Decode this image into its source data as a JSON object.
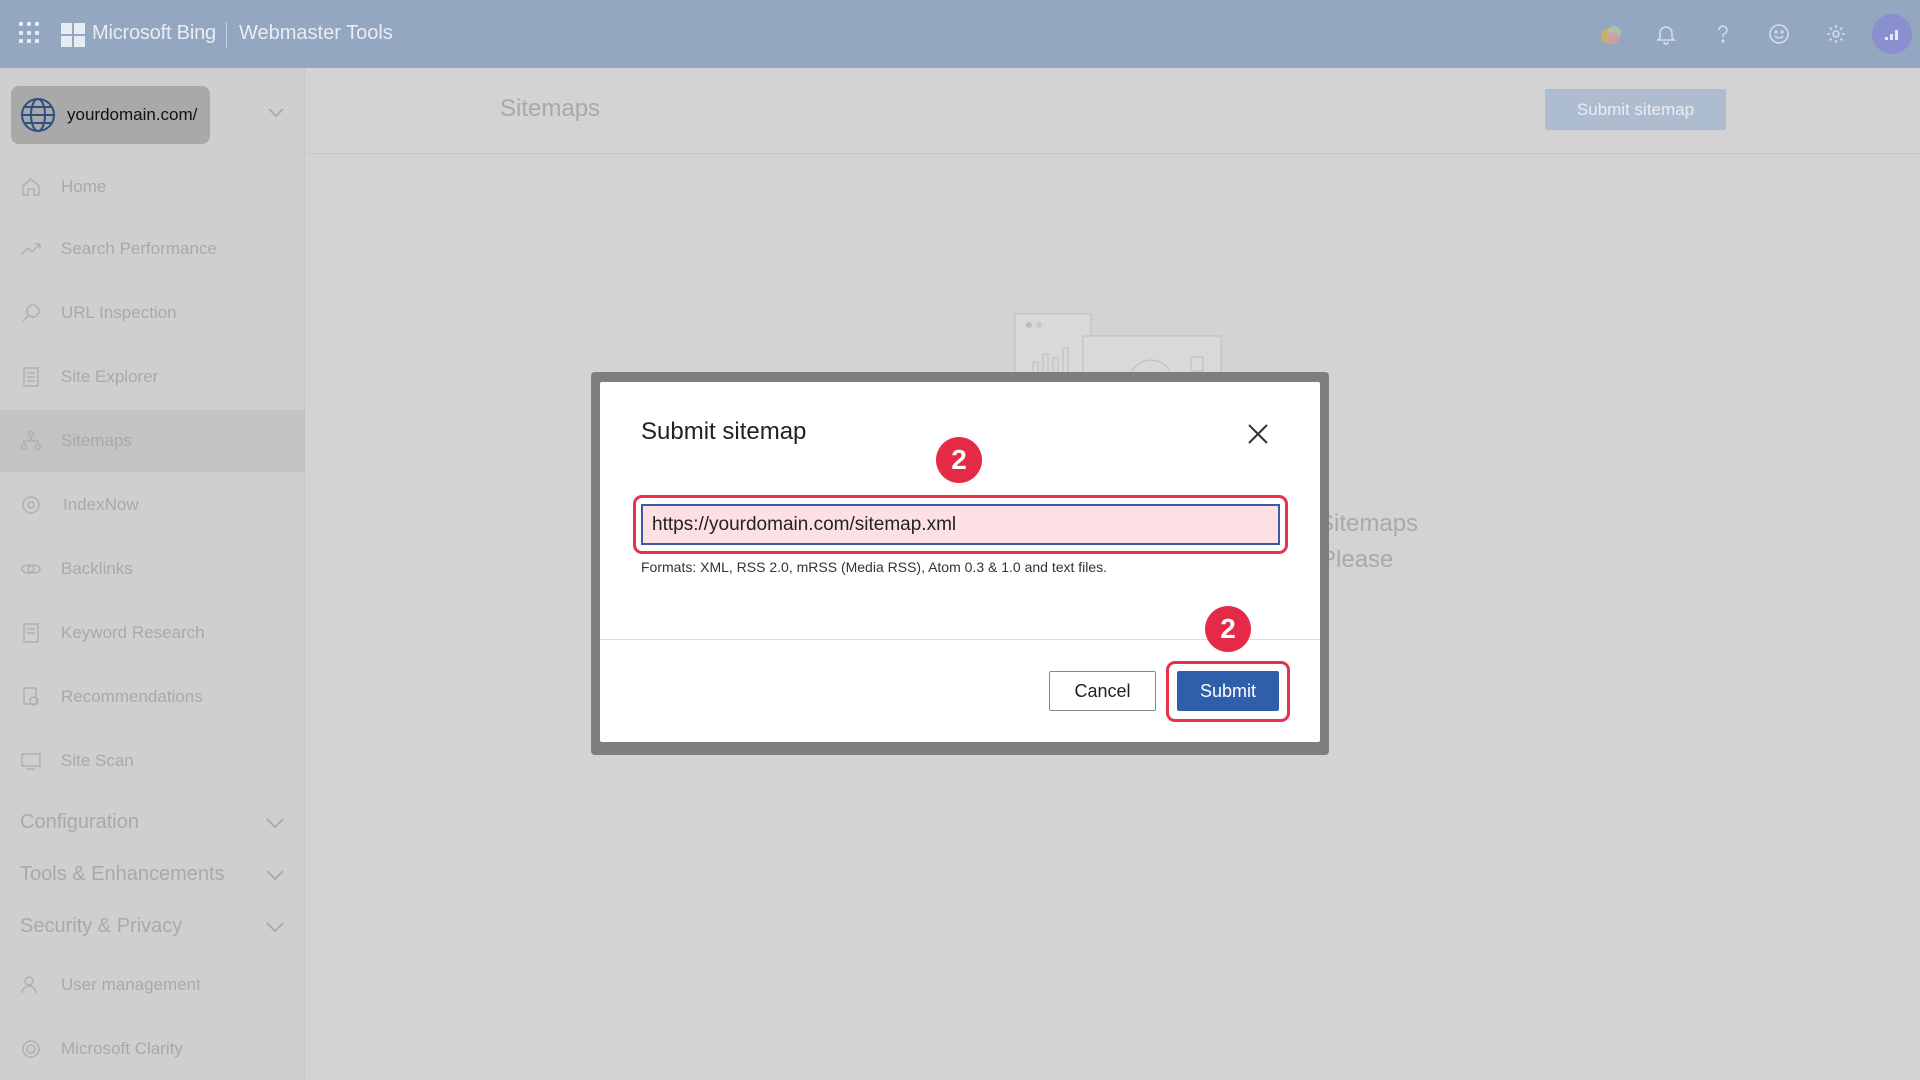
{
  "topbar": {
    "brand": "Microsoft Bing",
    "product": "Webmaster Tools",
    "icons": [
      "apps-waffle-icon",
      "microsoft-logo-icon",
      "rewards-icon",
      "bell-icon",
      "help-icon",
      "feedback-smiley-icon",
      "settings-gear-icon",
      "avatar"
    ]
  },
  "sidebar": {
    "domain": "yourdomain.com/",
    "items": [
      {
        "label": "Home",
        "icon": "home-icon"
      },
      {
        "label": "Search Performance",
        "icon": "trend-icon"
      },
      {
        "label": "URL Inspection",
        "icon": "search-icon"
      },
      {
        "label": "Site Explorer",
        "icon": "document-icon"
      },
      {
        "label": "Sitemaps",
        "icon": "sitemap-icon"
      },
      {
        "label": "IndexNow",
        "icon": "gear-icon"
      },
      {
        "label": "Backlinks",
        "icon": "link-icon"
      },
      {
        "label": "Keyword Research",
        "icon": "document-icon"
      },
      {
        "label": "Recommendations",
        "icon": "recommendations-icon"
      },
      {
        "label": "Site Scan",
        "icon": "monitor-icon"
      }
    ],
    "groups": [
      {
        "label": "Configuration"
      },
      {
        "label": "Tools & Enhancements"
      },
      {
        "label": "Security & Privacy"
      }
    ],
    "bottom_items": [
      {
        "label": "User management",
        "icon": "user-icon"
      },
      {
        "label": "Microsoft Clarity",
        "icon": "clarity-icon"
      }
    ]
  },
  "main": {
    "title": "Sitemaps",
    "submit_button": "Submit sitemap",
    "bg_text_1": "Sitemaps",
    "bg_text_2": "Please"
  },
  "modal": {
    "title": "Submit sitemap",
    "input_value": "https://yourdomain.com/sitemap.xml",
    "hint": "Formats: XML, RSS 2.0, mRSS (Media RSS), Atom 0.3 & 1.0 and text files.",
    "cancel_label": "Cancel",
    "submit_label": "Submit",
    "step_badge_1": "2",
    "step_badge_2": "2",
    "highlight_color": "#e8304a",
    "primary_color": "#2f5eaa"
  }
}
